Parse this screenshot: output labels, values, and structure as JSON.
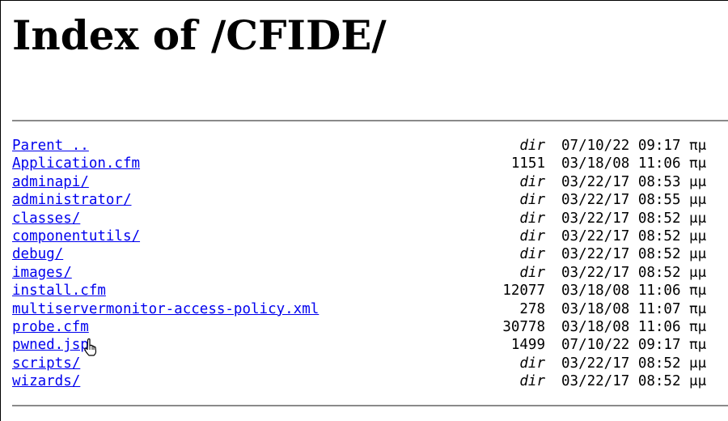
{
  "page": {
    "heading": "Index of /CFIDE/"
  },
  "listing": {
    "entries": [
      {
        "name": "Parent ..",
        "size": "dir",
        "is_dir": true,
        "modified": "07/10/22 09:17 πμ"
      },
      {
        "name": "Application.cfm",
        "size": "1151",
        "is_dir": false,
        "modified": "03/18/08 11:06 πμ"
      },
      {
        "name": "adminapi/",
        "size": "dir",
        "is_dir": true,
        "modified": "03/22/17 08:53 μμ"
      },
      {
        "name": "administrator/",
        "size": "dir",
        "is_dir": true,
        "modified": "03/22/17 08:55 μμ"
      },
      {
        "name": "classes/",
        "size": "dir",
        "is_dir": true,
        "modified": "03/22/17 08:52 μμ"
      },
      {
        "name": "componentutils/",
        "size": "dir",
        "is_dir": true,
        "modified": "03/22/17 08:52 μμ"
      },
      {
        "name": "debug/",
        "size": "dir",
        "is_dir": true,
        "modified": "03/22/17 08:52 μμ"
      },
      {
        "name": "images/",
        "size": "dir",
        "is_dir": true,
        "modified": "03/22/17 08:52 μμ"
      },
      {
        "name": "install.cfm",
        "size": "12077",
        "is_dir": false,
        "modified": "03/18/08 11:06 πμ"
      },
      {
        "name": "multiservermonitor-access-policy.xml",
        "size": "278",
        "is_dir": false,
        "modified": "03/18/08 11:07 πμ"
      },
      {
        "name": "probe.cfm",
        "size": "30778",
        "is_dir": false,
        "modified": "03/18/08 11:06 πμ"
      },
      {
        "name": "pwned.jsp",
        "size": "1499",
        "is_dir": false,
        "modified": "07/10/22 09:17 πμ"
      },
      {
        "name": "scripts/",
        "size": "dir",
        "is_dir": true,
        "modified": "03/22/17 08:52 μμ"
      },
      {
        "name": "wizards/",
        "size": "dir",
        "is_dir": true,
        "modified": "03/22/17 08:52 μμ"
      }
    ]
  },
  "cursor": {
    "icon": "hand-pointer-cursor-icon"
  }
}
